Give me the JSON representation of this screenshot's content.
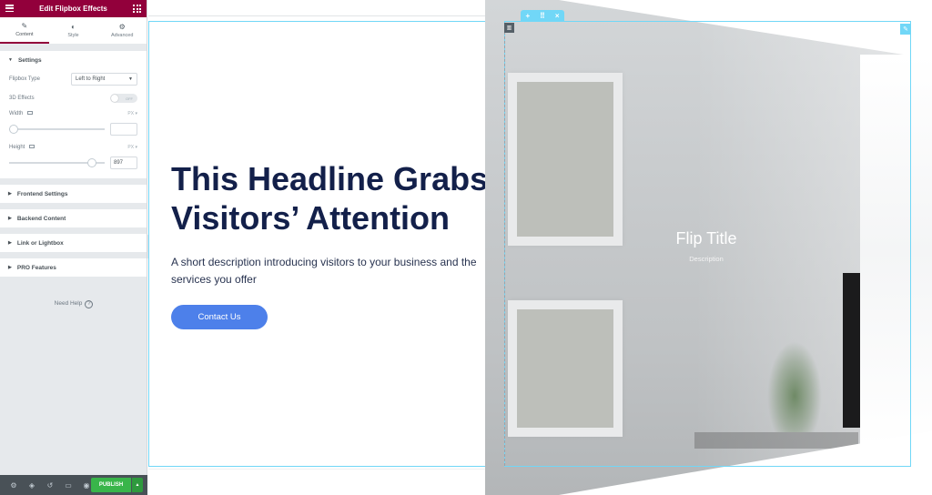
{
  "sidebar": {
    "title": "Edit Flipbox Effects",
    "tabs": [
      {
        "label": "Content",
        "icon": "pencil-icon"
      },
      {
        "label": "Style",
        "icon": "contrast-icon"
      },
      {
        "label": "Advanced",
        "icon": "gear-icon"
      }
    ],
    "settings_section": {
      "title": "Settings",
      "flipbox_type_label": "Flipbox Type",
      "flipbox_type_value": "Left to Right",
      "effects_3d_label": "3D Effects",
      "effects_3d_state": "OFF",
      "effects_3d_on": false,
      "width_label": "Width",
      "width_unit": "PX",
      "width_value": "",
      "width_slider_fraction": 0.0,
      "height_label": "Height",
      "height_unit": "PX",
      "height_value": "897",
      "height_slider_fraction": 0.9
    },
    "collapsed_sections": [
      "Frontend Settings",
      "Backend Content",
      "Link or Lightbox",
      "PRO Features"
    ],
    "need_help": "Need Help",
    "footer": {
      "icons": [
        "settings-icon",
        "layers-icon",
        "history-icon",
        "responsive-icon",
        "preview-eye-icon"
      ],
      "publish_label": "PUBLISH"
    }
  },
  "canvas": {
    "headline": "This Headline Grabs Visitors’ Attention",
    "description": "A short description introducing visitors to your business and the services you offer",
    "cta_label": "Contact Us",
    "flipbox": {
      "title": "Flip Title",
      "description": "Description"
    },
    "section_toolbar": {
      "add": "+",
      "move": "⠿",
      "close": "×"
    }
  },
  "colors": {
    "header": "#92003b",
    "accent_outline": "#71d7f7",
    "publish": "#39b54a",
    "cta": "#4d80ea",
    "headline": "#13204a"
  }
}
